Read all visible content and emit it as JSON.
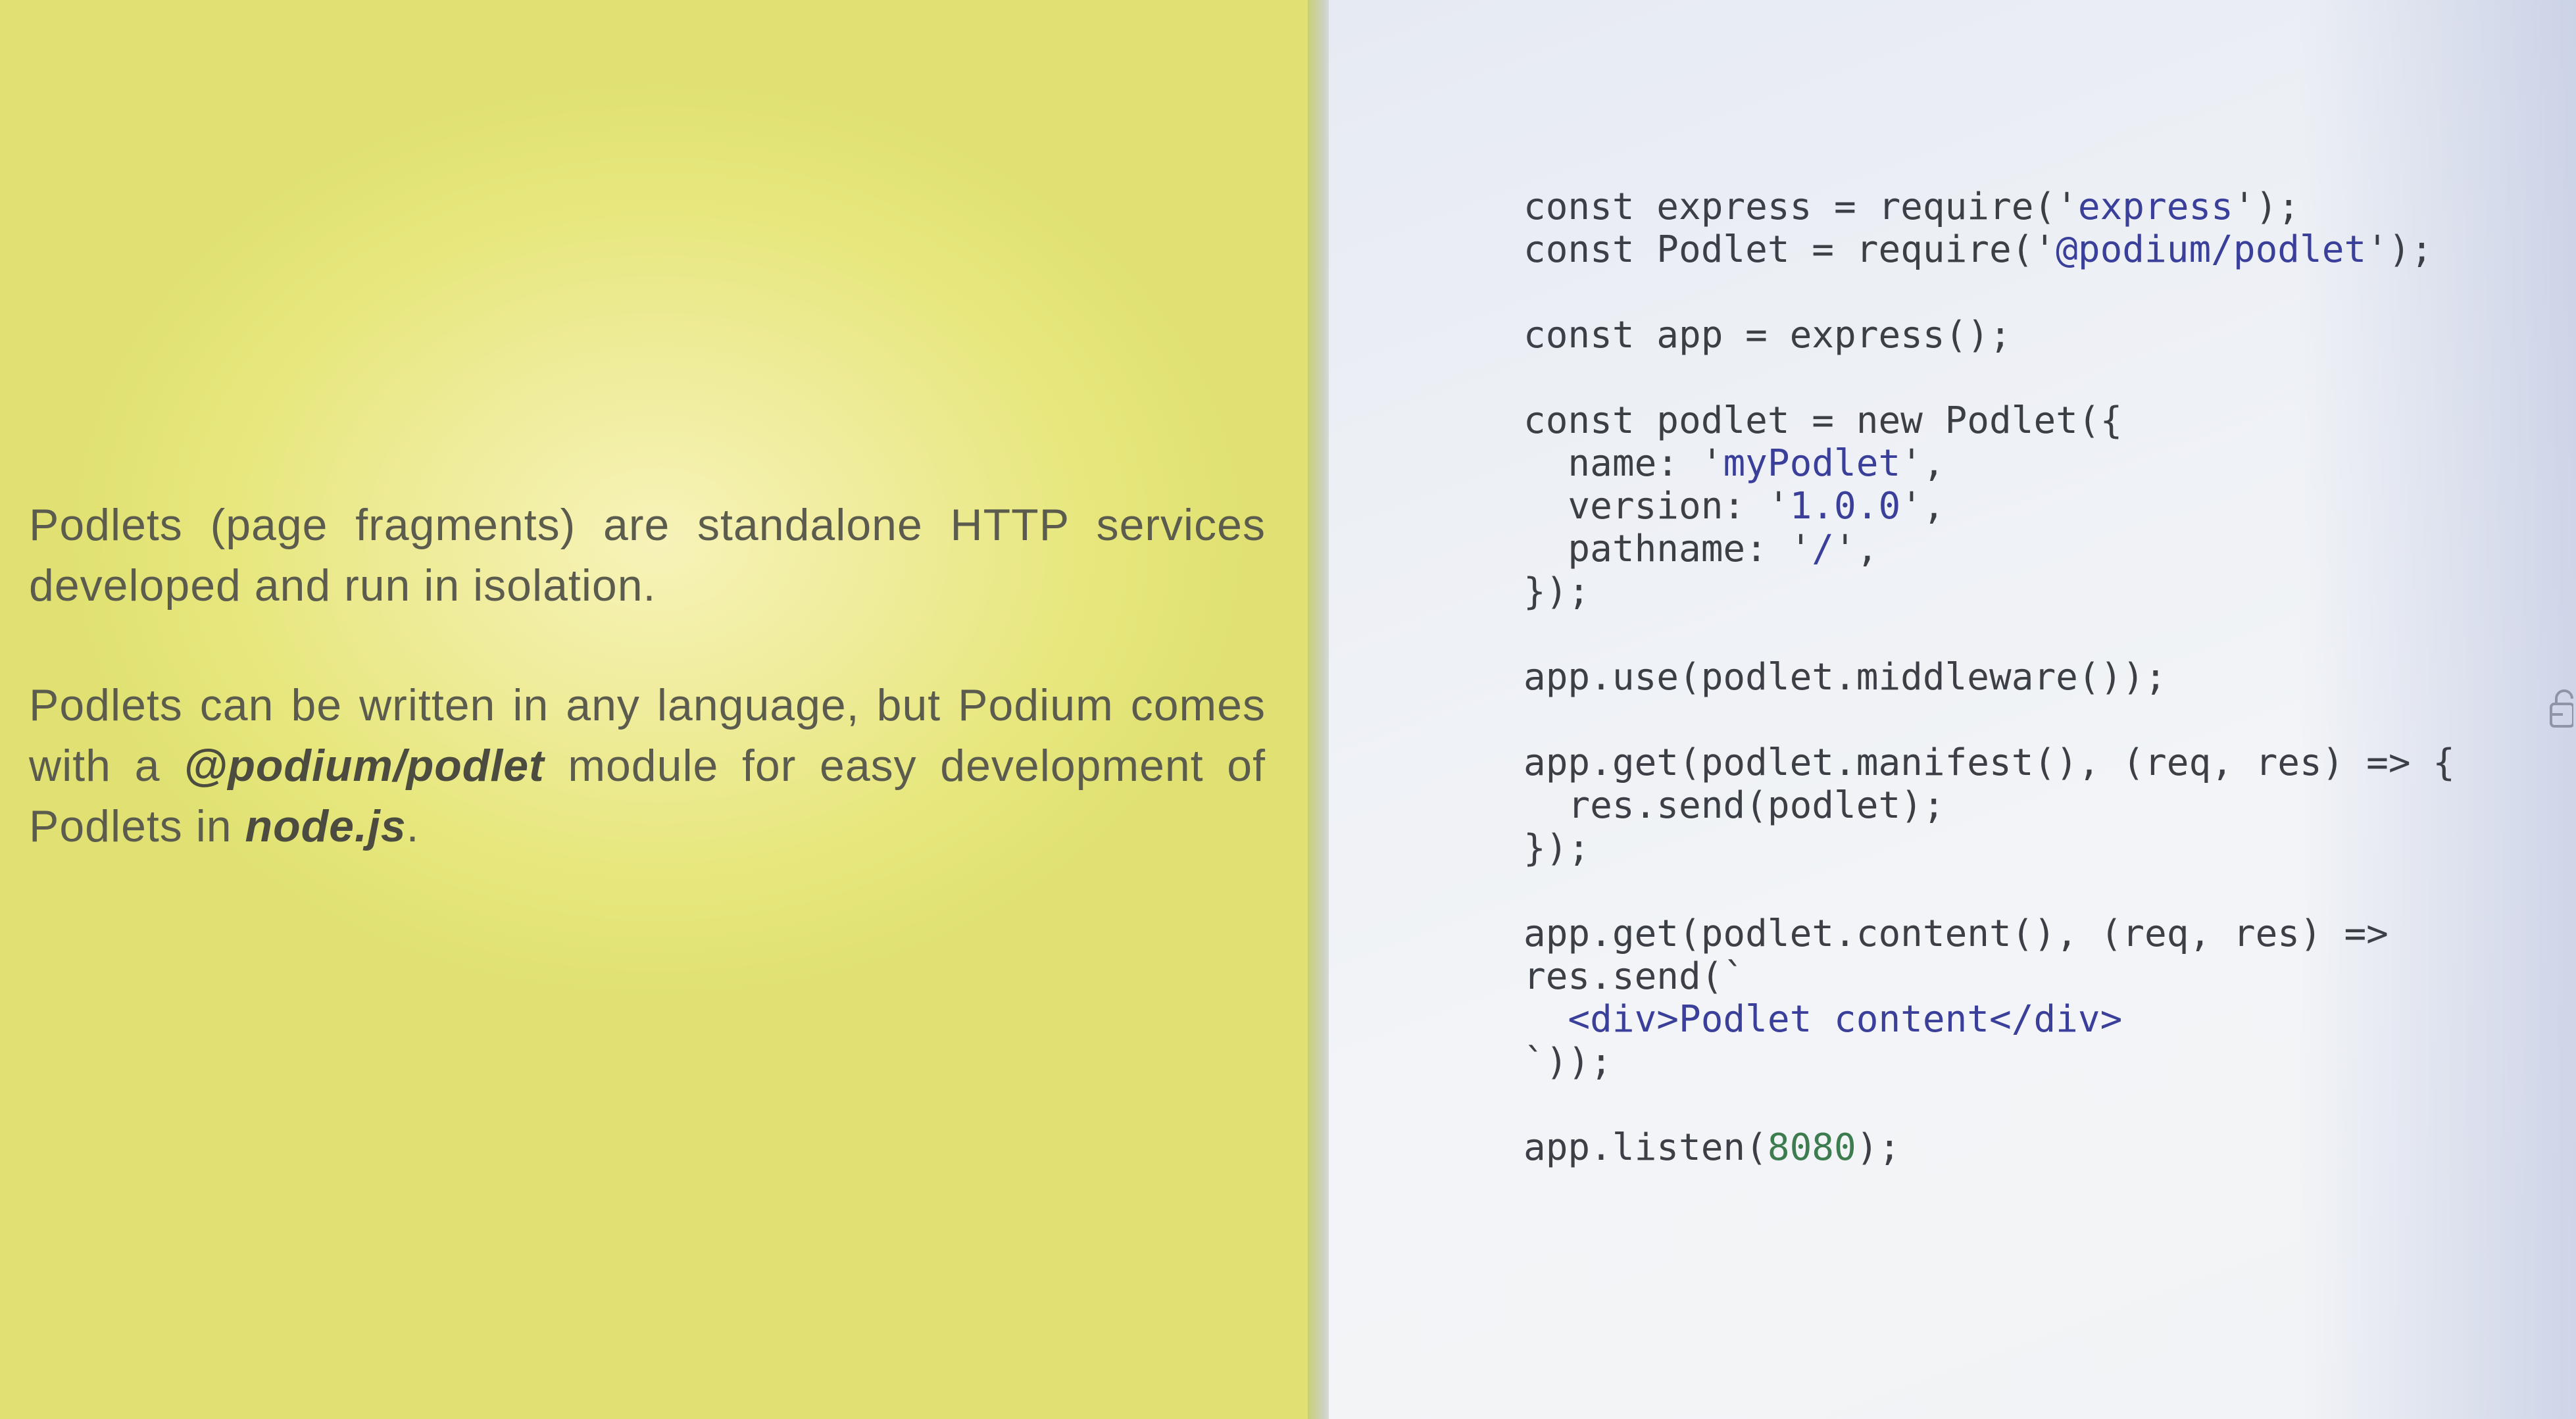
{
  "slide": {
    "paragraph1": "Podlets (page fragments) are standalone HTTP services developed and run in isolation.",
    "paragraph2": {
      "before": "Podlets can be written in any language, but Podium comes with a ",
      "module": "@podium/podlet",
      "middle": " module for easy development of Podlets in ",
      "runtime": "node.js",
      "after": "."
    }
  },
  "code": {
    "l1": {
      "pre": "const express = require('",
      "str": "express",
      "post": "');"
    },
    "l2": {
      "pre": "const Podlet = require('",
      "str": "@podium/podlet",
      "post": "');"
    },
    "l3": "const app = express();",
    "l4": "const podlet = new Podlet({",
    "l5": {
      "pre": "  name: '",
      "str": "myPodlet",
      "post": "',"
    },
    "l6": {
      "pre": "  version: '",
      "str": "1.0.0",
      "post": "',"
    },
    "l7": {
      "pre": "  pathname: '",
      "str": "/",
      "post": "',"
    },
    "l8": "});",
    "l9": "app.use(podlet.middleware());",
    "l10": "app.get(podlet.manifest(), (req, res) => {",
    "l11": "  res.send(podlet);",
    "l12": "});",
    "l13": "app.get(podlet.content(), (req, res) =>",
    "l14": "res.send(`",
    "l15": "  <div>Podlet content</div>",
    "l16": "`));",
    "l17": {
      "pre": "app.listen(",
      "num": "8080",
      "post": ");"
    }
  },
  "icons": {
    "edge": "lock-icon"
  },
  "colors": {
    "left_background": "#e7e77e",
    "right_background": "#f1f3f6",
    "string_literal": "#3a3f9a",
    "number_literal": "#3d7c4e"
  }
}
